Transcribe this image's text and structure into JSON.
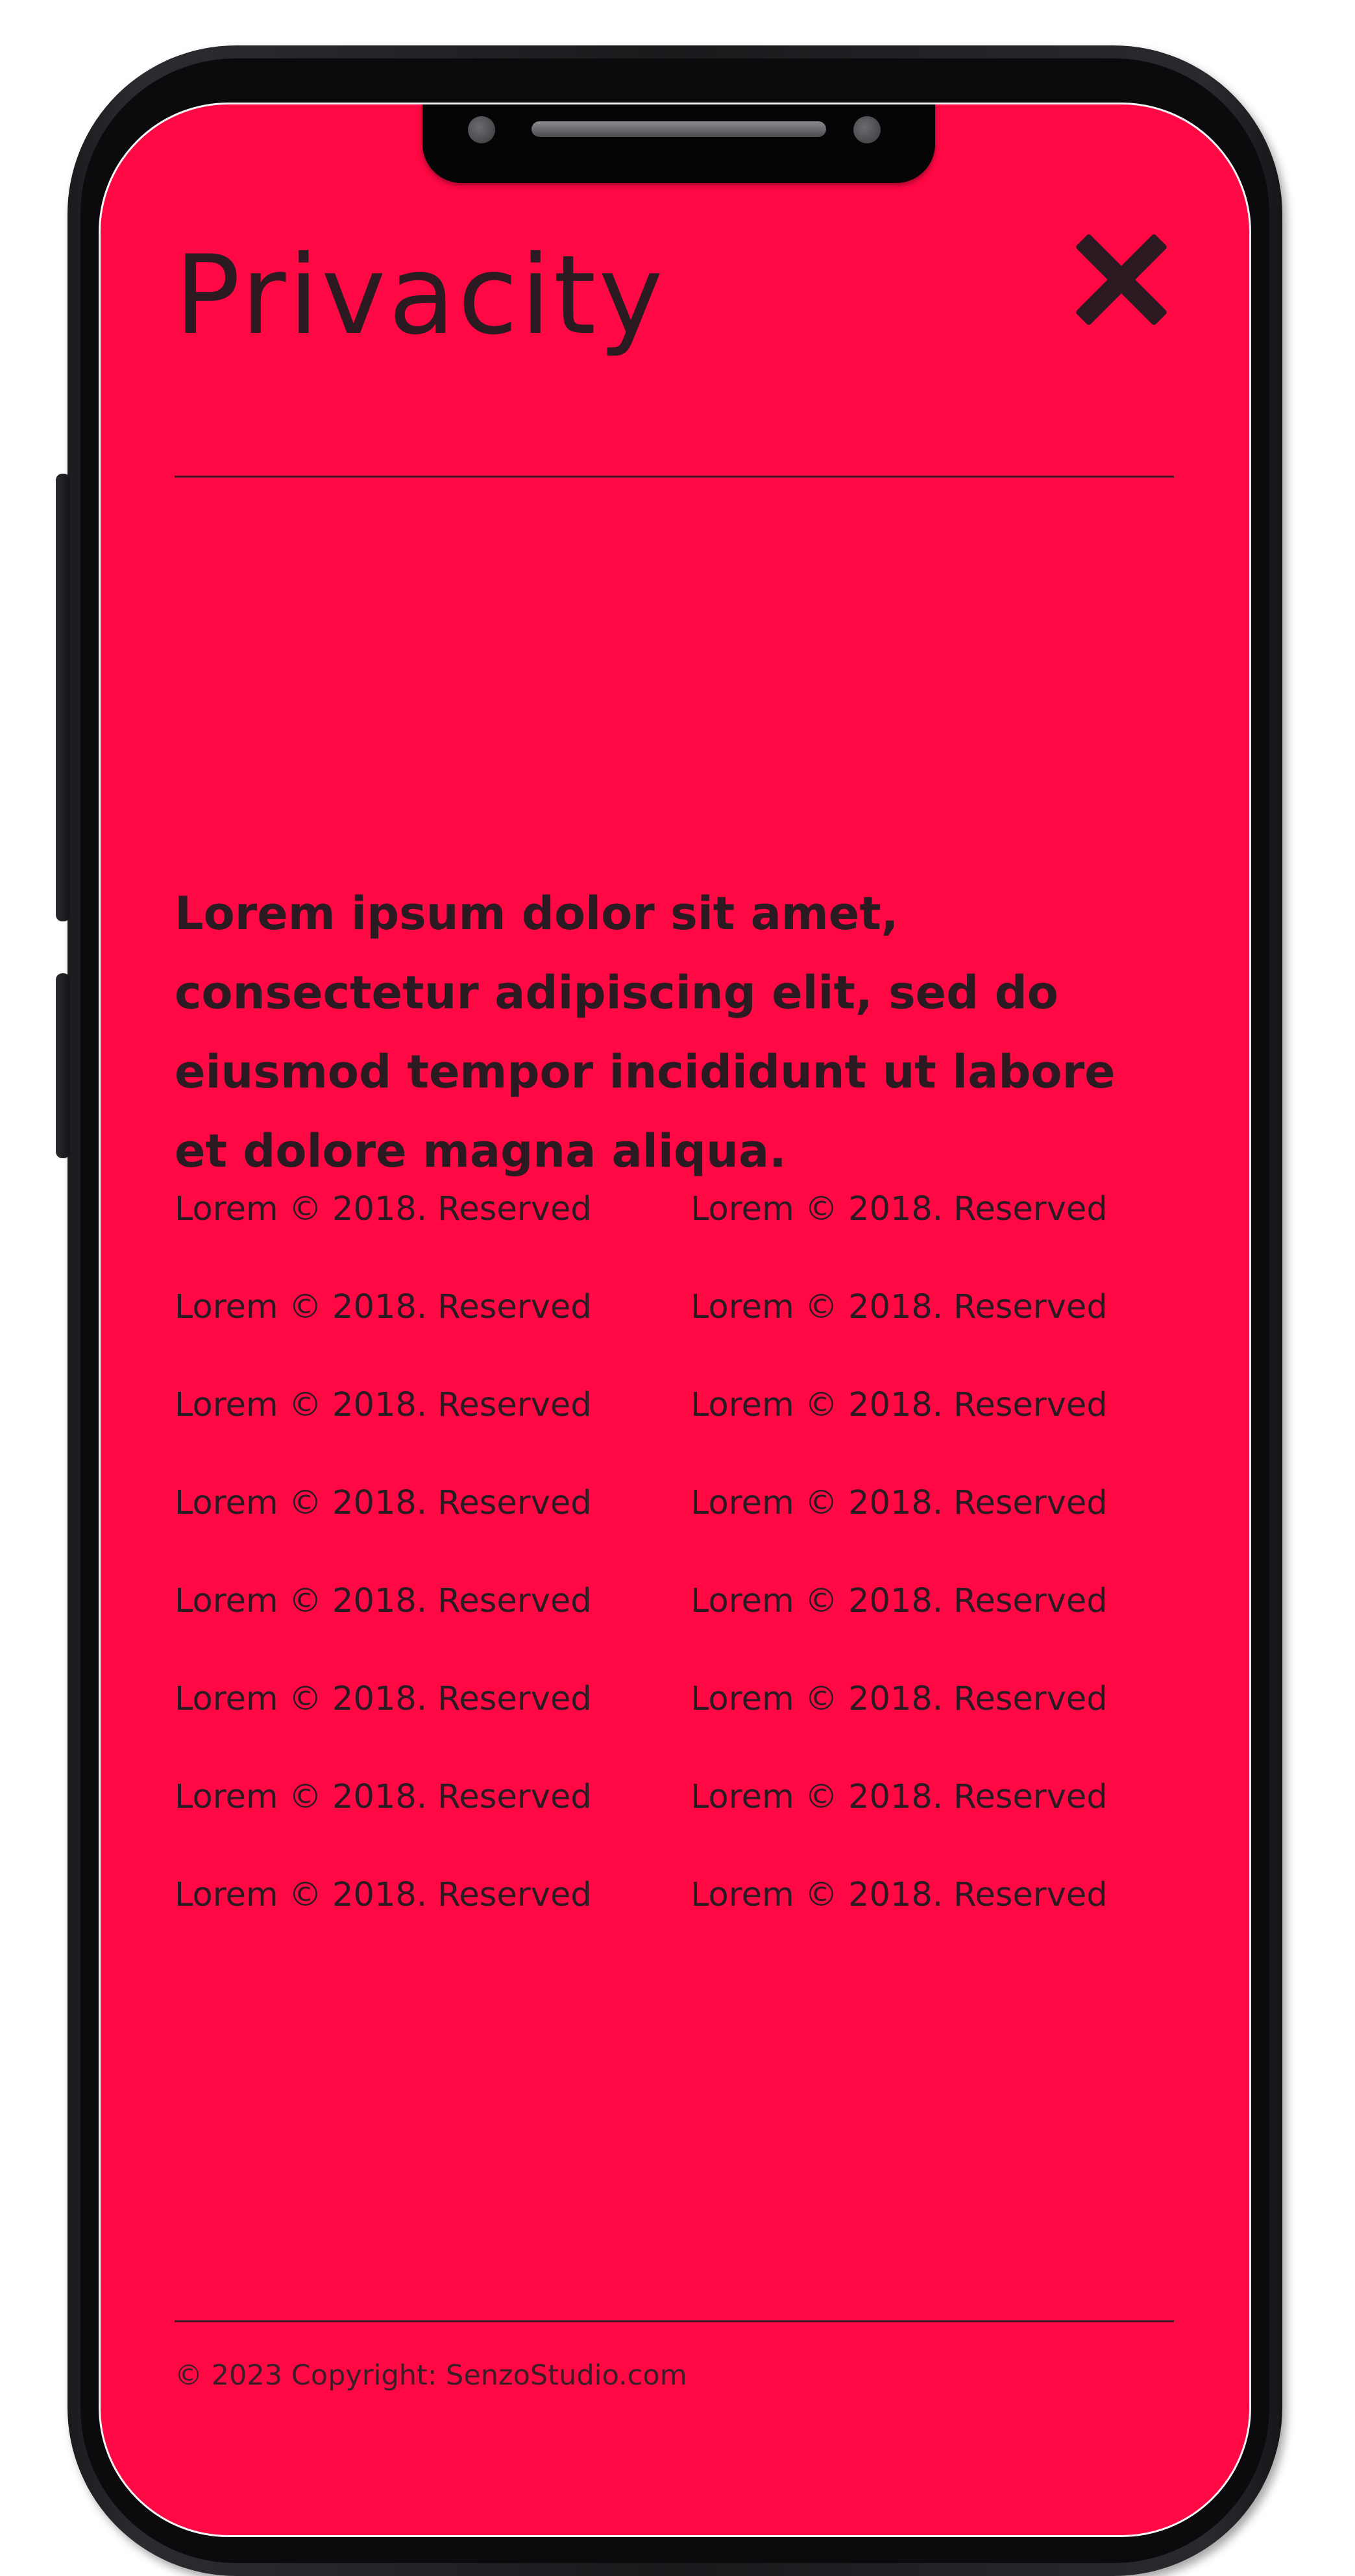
{
  "header": {
    "title": "Privacity",
    "close_icon": "close-icon"
  },
  "intro_text": "Lorem ipsum dolor sit amet, consectetur adipiscing elit, sed do eiusmod tempor incididunt ut labore et dolore magna aliqua.",
  "links": {
    "left": [
      "Lorem © 2018. Reserved",
      "Lorem © 2018. Reserved",
      "Lorem © 2018. Reserved",
      "Lorem © 2018. Reserved",
      "Lorem © 2018. Reserved",
      "Lorem © 2018. Reserved",
      "Lorem © 2018. Reserved",
      "Lorem © 2018. Reserved"
    ],
    "right": [
      "Lorem © 2018. Reserved",
      "Lorem © 2018. Reserved",
      "Lorem © 2018. Reserved",
      "Lorem © 2018. Reserved",
      "Lorem © 2018. Reserved",
      "Lorem © 2018. Reserved",
      "Lorem © 2018. Reserved",
      "Lorem © 2018. Reserved"
    ]
  },
  "footer": {
    "copyright": "© 2023 Copyright: SenzoStudio.com"
  },
  "colors": {
    "background": "#ff0844",
    "text": "#2b1a22",
    "device_frame": "#1b1b1e"
  }
}
